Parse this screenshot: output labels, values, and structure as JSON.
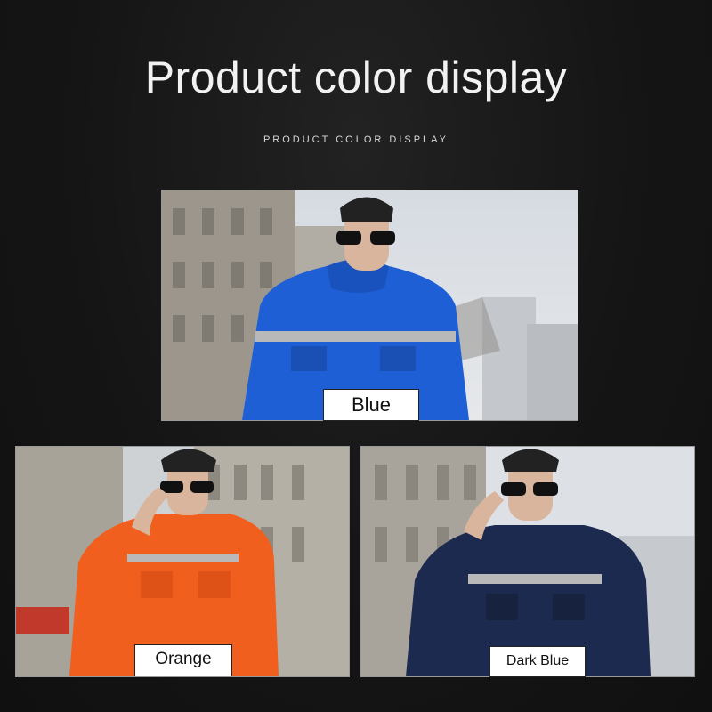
{
  "header": {
    "title": "Product color display",
    "subtitle": "PRODUCT COLOR DISPLAY"
  },
  "variants": [
    {
      "label": "Blue",
      "color": "#1f5fd6"
    },
    {
      "label": "Orange",
      "color": "#f05f1e"
    },
    {
      "label": "Dark Blue",
      "color": "#1c2a4f"
    }
  ],
  "colors": {
    "background": "#141414",
    "reflective_stripe": "#b9b9b9",
    "sky": "#dfe3e8",
    "building": "#a9a49b"
  }
}
